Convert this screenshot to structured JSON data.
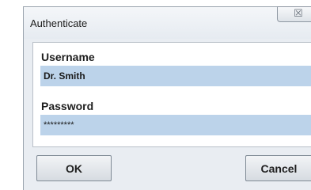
{
  "dialog": {
    "title": "Authenticate",
    "close_icon": "close-icon",
    "close_glyph": "☒"
  },
  "form": {
    "username_label": "Username",
    "username_value": "Dr. Smith",
    "password_label": "Password",
    "password_value": "*********"
  },
  "buttons": {
    "ok_label": "OK",
    "cancel_label": "Cancel"
  },
  "colors": {
    "field_background": "#bcd3ea",
    "dialog_background": "#e9edf2"
  }
}
